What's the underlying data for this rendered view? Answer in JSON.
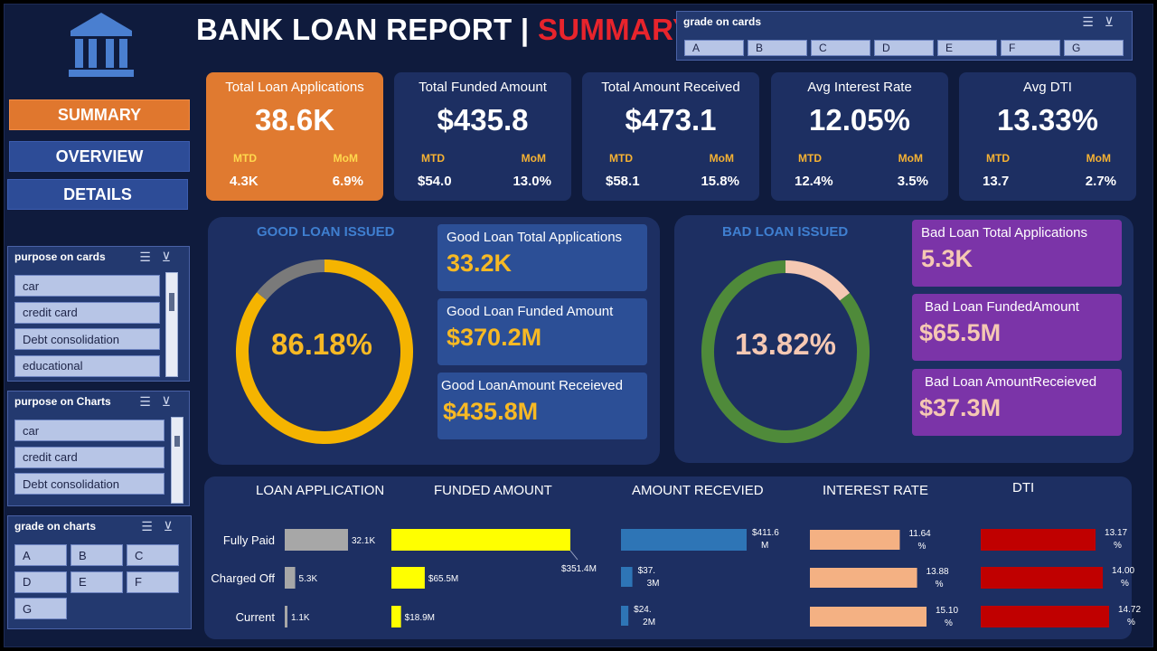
{
  "header": {
    "title_main": "BANK LOAN REPORT | ",
    "title_accent": "SUMMARY"
  },
  "nav": {
    "summary": "SUMMARY",
    "overview": "OVERVIEW",
    "details": "DETAILS"
  },
  "slicers": {
    "grade_cards": {
      "title": "grade on cards",
      "items": [
        "A",
        "B",
        "C",
        "D",
        "E",
        "F",
        "G"
      ]
    },
    "purpose_cards": {
      "title": "purpose on cards",
      "items": [
        "car",
        "credit card",
        "Debt consolidation",
        "educational"
      ]
    },
    "purpose_charts": {
      "title": "purpose on Charts",
      "items": [
        "car",
        "credit card",
        "Debt consolidation"
      ]
    },
    "grade_charts": {
      "title": "grade on charts",
      "items": [
        "A",
        "B",
        "C",
        "D",
        "E",
        "F",
        "G"
      ]
    }
  },
  "kpis": [
    {
      "label": "Total Loan Applications",
      "value": "38.6K",
      "mtd_label": "MTD",
      "mom_label": "MoM",
      "mtd": "4.3K",
      "mom": "6.9%"
    },
    {
      "label": "Total Funded Amount",
      "value": "$435.8",
      "mtd_label": "MTD",
      "mom_label": "MoM",
      "mtd": "$54.0",
      "mom": "13.0%"
    },
    {
      "label": "Total Amount Received",
      "value": "$473.1",
      "mtd_label": "MTD",
      "mom_label": "MoM",
      "mtd": "$58.1",
      "mom": "15.8%"
    },
    {
      "label": "Avg Interest Rate",
      "value": "12.05%",
      "mtd_label": "MTD",
      "mom_label": "MoM",
      "mtd": "12.4%",
      "mom": "3.5%"
    },
    {
      "label": "Avg DTI",
      "value": "13.33%",
      "mtd_label": "MTD",
      "mom_label": "MoM",
      "mtd": "13.7",
      "mom": "2.7%"
    }
  ],
  "good_loan": {
    "title": "GOOD LOAN ISSUED",
    "percent_label": "86.18%",
    "percent": 86.18,
    "apps_label": "Good Loan Total Applications",
    "apps_value": "33.2K",
    "funded_label": "Good Loan Funded Amount",
    "funded_value": "$370.2M",
    "received_label": "Good LoanAmount Receieved",
    "received_value": "$435.8M"
  },
  "bad_loan": {
    "title": "BAD LOAN ISSUED",
    "percent_label": "13.82%",
    "percent": 13.82,
    "apps_label": "Bad Loan Total Applications",
    "apps_value": "5.3K",
    "funded_label": "Bad Loan FundedAmount",
    "funded_value": "$65.5M",
    "received_label": "Bad Loan AmountReceieved",
    "received_value": "$37.3M"
  },
  "colors": {
    "good_ring": "#f5b400",
    "good_rest": "#7a7a7a",
    "bad_ring": "#f5c8b3",
    "bad_rest": "#4f8a3a",
    "loan_app_bar": "#a7a7a7",
    "funded_bar": "#ffff00",
    "received_bar": "#2e75b6",
    "interest_bar": "#f4b183",
    "dti_bar": "#c00000"
  },
  "chart_data": [
    {
      "type": "bar",
      "title": "LOAN APPLICATION",
      "categories": [
        "Fully Paid",
        "Charged Off",
        "Current"
      ],
      "values": [
        32.1,
        5.3,
        1.1
      ],
      "labels": [
        "32.1K",
        "5.3K",
        "1.1K"
      ]
    },
    {
      "type": "bar",
      "title": "FUNDED AMOUNT",
      "categories": [
        "Fully Paid",
        "Charged Off",
        "Current"
      ],
      "values": [
        351.4,
        65.5,
        18.9
      ],
      "labels": [
        "$351.4M",
        "$65.5M",
        "$18.9M"
      ]
    },
    {
      "type": "bar",
      "title": "AMOUNT RECEVIED",
      "categories": [
        "Fully Paid",
        "Charged Off",
        "Current"
      ],
      "values": [
        411.6,
        37.3,
        24.2
      ],
      "labels": [
        "$411.6M",
        "$37.3M",
        "$24.2M"
      ]
    },
    {
      "type": "bar",
      "title": "INTEREST RATE",
      "categories": [
        "Fully Paid",
        "Charged Off",
        "Current"
      ],
      "values": [
        11.64,
        13.88,
        15.1
      ],
      "labels": [
        "11.64%",
        "13.88%",
        "15.10%"
      ]
    },
    {
      "type": "bar",
      "title": "DTI",
      "categories": [
        "Fully Paid",
        "Charged Off",
        "Current"
      ],
      "values": [
        13.17,
        14.0,
        14.72
      ],
      "labels": [
        "13.17%",
        "14.00%",
        "14.72%"
      ]
    }
  ]
}
